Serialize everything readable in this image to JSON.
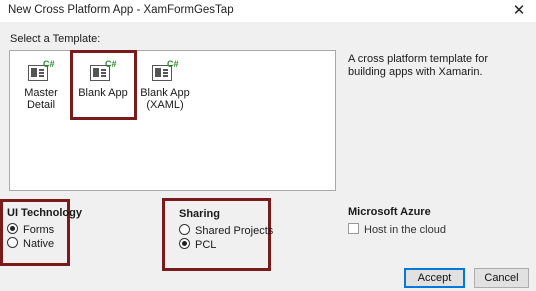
{
  "window": {
    "title": "New Cross Platform App - XamFormGesTap",
    "close_glyph": "✕"
  },
  "templates": {
    "label": "Select a Template:",
    "items": [
      {
        "label": "Master Detail",
        "icon": "master-detail-template-icon"
      },
      {
        "label": "Blank App",
        "icon": "blank-app-template-icon"
      },
      {
        "label": "Blank App (XAML)",
        "icon": "blank-app-xaml-template-icon"
      }
    ],
    "badge": "C#",
    "description": "A cross platform template for building apps with Xamarin."
  },
  "ui_technology": {
    "title": "UI Technology",
    "options": [
      {
        "label": "Forms",
        "selected": true
      },
      {
        "label": "Native",
        "selected": false
      }
    ]
  },
  "sharing": {
    "title": "Sharing",
    "options": [
      {
        "label": "Shared Projects",
        "selected": false
      },
      {
        "label": "PCL",
        "selected": true
      }
    ]
  },
  "azure": {
    "title": "Microsoft Azure",
    "host_label": "Host in the cloud",
    "host_checked": false
  },
  "buttons": {
    "accept": "Accept",
    "cancel": "Cancel"
  },
  "colors": {
    "highlight": "#7a1b1b",
    "csharp_badge": "#2e8b2e",
    "accent": "#0078d7"
  }
}
